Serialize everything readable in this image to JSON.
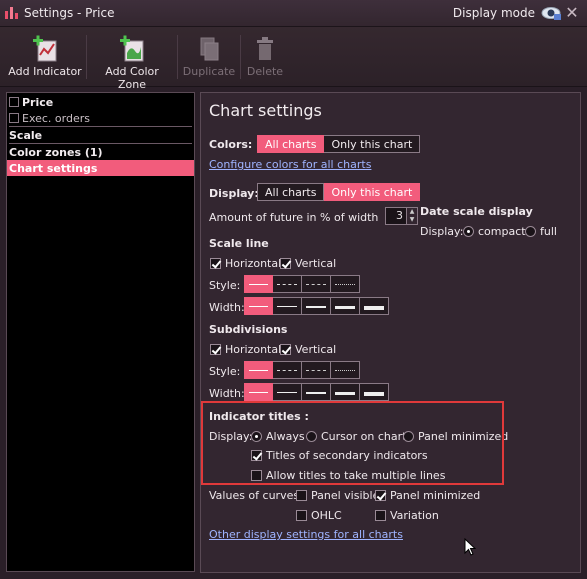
{
  "window": {
    "title": "Settings - Price",
    "display_mode_label": "Display mode"
  },
  "toolbar": {
    "add_indicator": "Add Indicator",
    "add_color_zone": "Add Color Zone",
    "duplicate": "Duplicate",
    "delete": "Delete"
  },
  "tree": {
    "price": "Price",
    "exec_orders": "Exec. orders",
    "scale": "Scale",
    "color_zones": "Color zones (1)",
    "chart_settings": "Chart settings"
  },
  "panel": {
    "title": "Chart settings",
    "colors_label": "Colors:",
    "colors_all": "All charts",
    "colors_only": "Only this chart",
    "configure_link": "Configure colors for all charts",
    "display_label": "Display:",
    "display_all": "All charts",
    "display_only": "Only this chart",
    "future_label": "Amount of future in % of width",
    "future_value": "3",
    "date_scale_title": "Date scale display",
    "date_display_label": "Display:",
    "date_compact": "compact",
    "date_full": "full",
    "scale_line_title": "Scale line",
    "scale_horizontal": "Horizontal",
    "scale_vertical": "Vertical",
    "style_label": "Style:",
    "width_label": "Width:",
    "subdivisions_title": "Subdivisions",
    "sub_horizontal": "Horizontal",
    "sub_vertical": "Vertical",
    "sub_style_label": "Style:",
    "sub_width_label": "Width:",
    "indicator_titles_title": "Indicator titles :",
    "ind_display_label": "Display:",
    "ind_always": "Always",
    "ind_cursor": "Cursor on chart",
    "ind_panel_min": "Panel minimized",
    "titles_secondary": "Titles of secondary indicators",
    "allow_multiple": "Allow titles to take multiple lines",
    "values_label": "Values of curves:",
    "val_panel_visible": "Panel visible",
    "val_panel_minimized": "Panel minimized",
    "val_ohlc": "OHLC",
    "val_variation": "Variation",
    "other_link": "Other display settings for all charts"
  },
  "state": {
    "colors_selected": "All charts",
    "display_selected": "Only this chart",
    "date_selected": "compact",
    "scale_horizontal": true,
    "scale_vertical": true,
    "sub_horizontal": true,
    "sub_vertical": true,
    "ind_display_selected": "Always",
    "titles_secondary": true,
    "allow_multiple": false,
    "val_panel_visible": false,
    "val_panel_minimized": true,
    "val_ohlc": false,
    "val_variation": false
  },
  "colors": {
    "accent": "#f25c7c",
    "highlight_box": "#e0393a",
    "link": "#9fb4ff"
  }
}
